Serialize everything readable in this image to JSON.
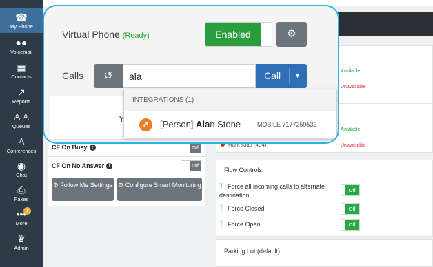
{
  "sidebar": {
    "items": [
      {
        "label": "My Phone",
        "icon": "phone-icon"
      },
      {
        "label": "Voicemail",
        "icon": "voicemail-icon"
      },
      {
        "label": "Contacts",
        "icon": "contacts-icon"
      },
      {
        "label": "Reports",
        "icon": "reports-icon"
      },
      {
        "label": "Queues",
        "icon": "queues-icon"
      },
      {
        "label": "Conferences",
        "icon": "conferences-icon"
      },
      {
        "label": "Chat",
        "icon": "chat-icon"
      },
      {
        "label": "Faxes",
        "icon": "fax-icon"
      },
      {
        "label": "More",
        "icon": "more-icon"
      },
      {
        "label": "Admin",
        "icon": "admin-icon"
      }
    ]
  },
  "virtual_phone": {
    "title": "Virtual Phone",
    "status": "(Ready)",
    "toggle_label": "Enabled",
    "calls_label": "Calls",
    "search_value": "ala",
    "call_button": "Call",
    "under_text": "Yo"
  },
  "dropdown": {
    "header": "INTEGRATIONS (1)",
    "item": {
      "prefix": "[Person] ",
      "match": "Ala",
      "rest": "n Stone",
      "number": "MOBILE 7177259532"
    }
  },
  "call_forward": {
    "busy_label": "CF On Busy",
    "no_answer_label": "CF On No Answer",
    "toggle_off": "Off",
    "follow_me_button": "Follow Me Settings",
    "smart_button": "Configure Smart Monitoring"
  },
  "status_list": {
    "rows": [
      "Available",
      "Unavailable",
      "Available",
      "Unavailable"
    ],
    "person": "Mark Kitts (404)"
  },
  "flow_controls": {
    "title": "Flow Controls",
    "items": [
      {
        "label": "Force all incoming calls to alternate destination",
        "state": "Off"
      },
      {
        "label": "Force Closed",
        "state": "Off"
      },
      {
        "label": "Force Open",
        "state": "Off"
      }
    ]
  },
  "parking_lot": {
    "title": "Parking Lot (default)"
  },
  "colors": {
    "accent": "#2ab3e4",
    "enabled": "#2a9d3f",
    "sidebar": "#2e3a46",
    "call": "#2f6fb5"
  }
}
